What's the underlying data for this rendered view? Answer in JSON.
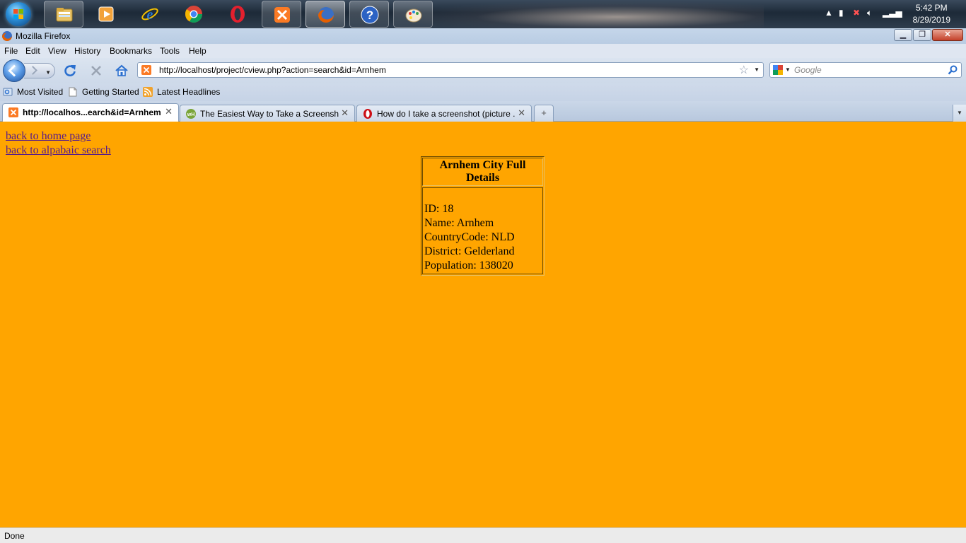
{
  "taskbar": {
    "apps": [
      "Windows Explorer",
      "Windows Media Player",
      "Internet Explorer",
      "Google Chrome",
      "Opera",
      "XAMPP Control Panel",
      "Mozilla Firefox",
      "Help and Support",
      "Paint"
    ],
    "clock": {
      "time": "5:42 PM",
      "date": "8/29/2019"
    }
  },
  "window": {
    "title": "Mozilla Firefox"
  },
  "menu": {
    "items": [
      "File",
      "Edit",
      "View",
      "History",
      "Bookmarks",
      "Tools",
      "Help"
    ]
  },
  "nav": {
    "url": "http://localhost/project/cview.php?action=search&id=Arnhem",
    "search_placeholder": "Google"
  },
  "bookmarks": {
    "items": [
      "Most Visited",
      "Getting Started",
      "Latest Headlines"
    ]
  },
  "tabs": [
    {
      "label": "http://localhos...earch&id=Arnhem",
      "selected": true
    },
    {
      "label": "The Easiest Way to Take a Screensh...",
      "selected": false
    },
    {
      "label": "How do I take a screenshot (picture ...",
      "selected": false
    }
  ],
  "page": {
    "links": {
      "home": "back to home page",
      "alpha": "back to alpabaic search"
    },
    "details": {
      "heading": "Arnhem City Full Details",
      "id": "ID: 18",
      "name": "Name: Arnhem",
      "country_code": "CountryCode: NLD",
      "district": "District: Gelderland",
      "population": "Population: 138020"
    }
  },
  "status": {
    "text": "Done"
  },
  "colors": {
    "page_background": "#ffa500",
    "link": "#551a8b"
  }
}
